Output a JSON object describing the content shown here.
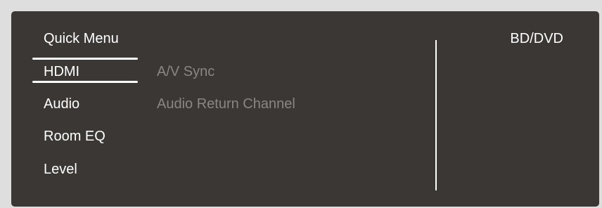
{
  "menu": {
    "title": "Quick Menu",
    "items": [
      {
        "label": "HDMI",
        "selected": true
      },
      {
        "label": "Audio"
      },
      {
        "label": "Room EQ"
      },
      {
        "label": "Level"
      }
    ]
  },
  "submenu": {
    "items": [
      {
        "label": "A/V Sync"
      },
      {
        "label": "Audio Return Channel"
      }
    ]
  },
  "source": {
    "label": "BD/DVD"
  },
  "colors": {
    "panel": "#3b3735",
    "text": "#ffffff",
    "disabled_text": "#8a8683",
    "background": "#dedede"
  }
}
